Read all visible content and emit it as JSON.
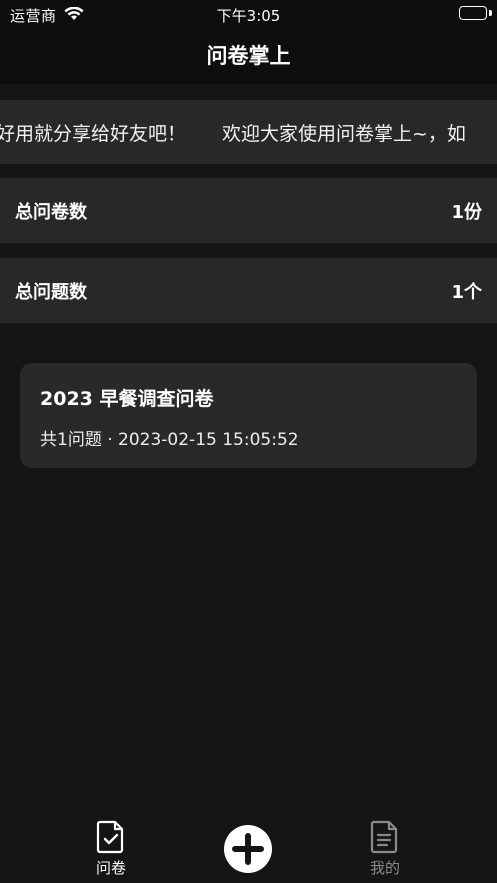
{
  "status_bar": {
    "carrier": "运营商",
    "time": "下午3:05"
  },
  "nav": {
    "title": "问卷掌上"
  },
  "marquee": {
    "segments": [
      "好用就分享给好友吧！",
      "欢迎大家使用问卷掌上~，如"
    ]
  },
  "stats": [
    {
      "label": "总问卷数",
      "value": "1份"
    },
    {
      "label": "总问题数",
      "value": "1个"
    }
  ],
  "surveys": [
    {
      "title": "2023 早餐调查问卷",
      "meta": "共1问题 · 2023-02-15 15:05:52"
    }
  ],
  "tab_bar": {
    "tabs": [
      {
        "label": "问卷",
        "icon": "survey-doc-icon",
        "active": true
      },
      {
        "label": "",
        "icon": "plus-circle-icon",
        "active": false
      },
      {
        "label": "我的",
        "icon": "document-icon",
        "active": false
      }
    ]
  },
  "colors": {
    "background": "#161415",
    "bar": "#0f0e0f",
    "card": "#29272a",
    "text": "#ffffff",
    "inactive": "#8a8a8a"
  }
}
